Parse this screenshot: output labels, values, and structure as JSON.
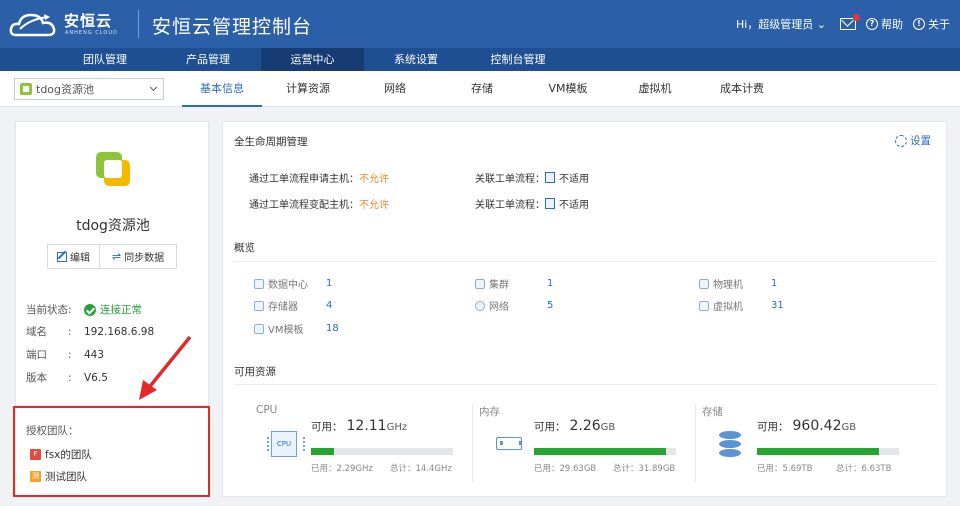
{
  "header": {
    "logo_text": "安恒云",
    "logo_sub": "ANHENG CLOUD",
    "app_title": "安恒云管理控制台",
    "user_label": "Hi，超级管理员",
    "help_label": "帮助",
    "about_label": "关于"
  },
  "nav": {
    "items": [
      {
        "label": "团队管理"
      },
      {
        "label": "产品管理"
      },
      {
        "label": "运营中心"
      },
      {
        "label": "系统设置"
      },
      {
        "label": "控制台管理"
      }
    ],
    "active_index": 2
  },
  "subnav": {
    "pool_select_value": "tdog资源池",
    "tabs": [
      {
        "label": "基本信息"
      },
      {
        "label": "计算资源"
      },
      {
        "label": "网络"
      },
      {
        "label": "存储"
      },
      {
        "label": "VM模板"
      },
      {
        "label": "虚拟机"
      },
      {
        "label": "成本计费"
      }
    ],
    "active_index": 0
  },
  "left": {
    "pool_name": "tdog资源池",
    "edit_label": "编辑",
    "sync_label": "同步数据",
    "status_key": "当前状态",
    "status_value": "连接正常",
    "domain_key": "域名",
    "domain_value": "192.168.6.98",
    "port_key": "端口",
    "port_value": "443",
    "version_key": "版本",
    "version_value": "V6.5",
    "colon": ":",
    "team_title": "授权团队：",
    "teams": [
      {
        "badge": "F",
        "name": "fsx的团队",
        "color": "#e8493c"
      },
      {
        "badge": "测",
        "name": "测试团队",
        "color": "#f0a22a"
      }
    ]
  },
  "lifecycle": {
    "title": "全生命周期管理",
    "settings_label": "设置",
    "rows": [
      {
        "label": "通过工单流程申请主机：",
        "value": "不允许",
        "flow_label": "关联工单流程：",
        "flow_value": "不适用"
      },
      {
        "label": "通过工单流程变配主机：",
        "value": "不允许",
        "flow_label": "关联工单流程：",
        "flow_value": "不适用"
      }
    ]
  },
  "overview": {
    "title": "概览",
    "items": [
      {
        "label": "数据中心",
        "value": "1"
      },
      {
        "label": "集群",
        "value": "1"
      },
      {
        "label": "物理机",
        "value": "1"
      },
      {
        "label": "存储器",
        "value": "4"
      },
      {
        "label": "网络",
        "value": "5"
      },
      {
        "label": "虚拟机",
        "value": "31"
      },
      {
        "label": "VM模板",
        "value": "18"
      }
    ]
  },
  "resources": {
    "title": "可用资源",
    "avail_label": "可用：",
    "items": [
      {
        "name": "CPU",
        "value": "12.11",
        "unit": "GHz",
        "used": "已用：2.29GHz",
        "total": "总计：14.4GHz",
        "fill_ratio": 0.16,
        "icon": "cpu-icon"
      },
      {
        "name": "内存",
        "value": "2.26",
        "unit": "GB",
        "used": "已用：29.63GB",
        "total": "总计：31.89GB",
        "fill_ratio": 0.93,
        "icon": "memory-icon"
      },
      {
        "name": "存储",
        "value": "960.42",
        "unit": "GB",
        "used": "已用：5.69TB",
        "total": "总计：6.63TB",
        "fill_ratio": 0.86,
        "icon": "database-icon"
      }
    ],
    "bar_color": "#25a52f"
  },
  "colors": {
    "header_bg": "#2b5fa8",
    "nav_bg": "#1f4f93",
    "accent": "#2b6cc4",
    "warn": "#f0892a",
    "ok": "#2aa03c",
    "highlight_box": "#e02a2a"
  }
}
